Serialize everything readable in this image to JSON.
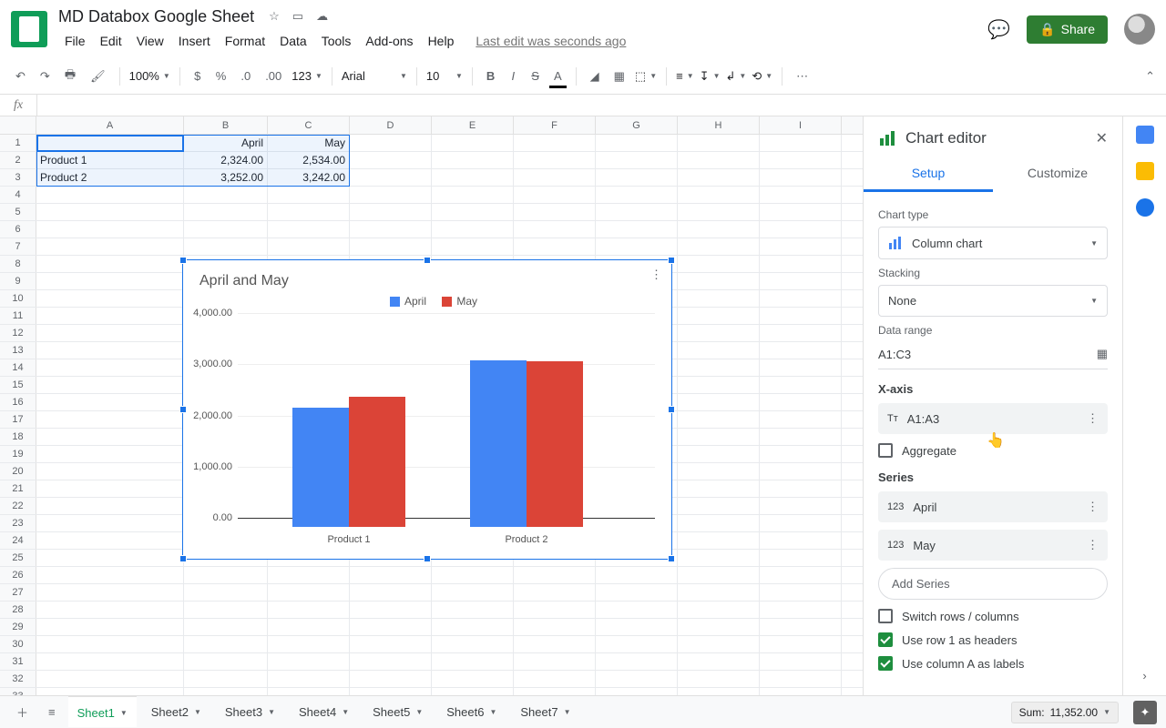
{
  "doc": {
    "title": "MD Databox Google Sheet",
    "last_edit": "Last edit was seconds ago"
  },
  "menus": [
    "File",
    "Edit",
    "View",
    "Insert",
    "Format",
    "Data",
    "Tools",
    "Add-ons",
    "Help"
  ],
  "toolbar": {
    "zoom": "100%",
    "font": "Arial",
    "size": "10"
  },
  "share": {
    "label": "Share"
  },
  "columns": [
    "A",
    "B",
    "C",
    "D",
    "E",
    "F",
    "G",
    "H",
    "I"
  ],
  "cells": {
    "B1": "April",
    "C1": "May",
    "A2": "Product 1",
    "B2": "2,324.00",
    "C2": "2,534.00",
    "A3": "Product 2",
    "B3": "3,252.00",
    "C3": "3,242.00"
  },
  "chart_data": {
    "type": "bar",
    "title": "April and May",
    "categories": [
      "Product 1",
      "Product 2"
    ],
    "series": [
      {
        "name": "April",
        "color": "#4285f4",
        "values": [
          2324.0,
          3252.0
        ]
      },
      {
        "name": "May",
        "color": "#db4437",
        "values": [
          2534.0,
          3242.0
        ]
      }
    ],
    "ylim": [
      0,
      4000
    ],
    "yticks": [
      "0.00",
      "1,000.00",
      "2,000.00",
      "3,000.00",
      "4,000.00"
    ]
  },
  "editor": {
    "title": "Chart editor",
    "tabs": {
      "setup": "Setup",
      "customize": "Customize"
    },
    "chart_type_label": "Chart type",
    "chart_type_value": "Column chart",
    "stacking_label": "Stacking",
    "stacking_value": "None",
    "data_range_label": "Data range",
    "data_range_value": "A1:C3",
    "xaxis_label": "X-axis",
    "xaxis_value": "A1:A3",
    "aggregate": "Aggregate",
    "series_label": "Series",
    "series1": "April",
    "series2": "May",
    "add_series": "Add Series",
    "switch": "Switch rows / columns",
    "row1_headers": "Use row 1 as headers",
    "colA_labels": "Use column A as labels"
  },
  "sheets": [
    "Sheet1",
    "Sheet2",
    "Sheet3",
    "Sheet4",
    "Sheet5",
    "Sheet6",
    "Sheet7"
  ],
  "status": {
    "sum_label": "Sum:",
    "sum_value": "11,352.00"
  }
}
